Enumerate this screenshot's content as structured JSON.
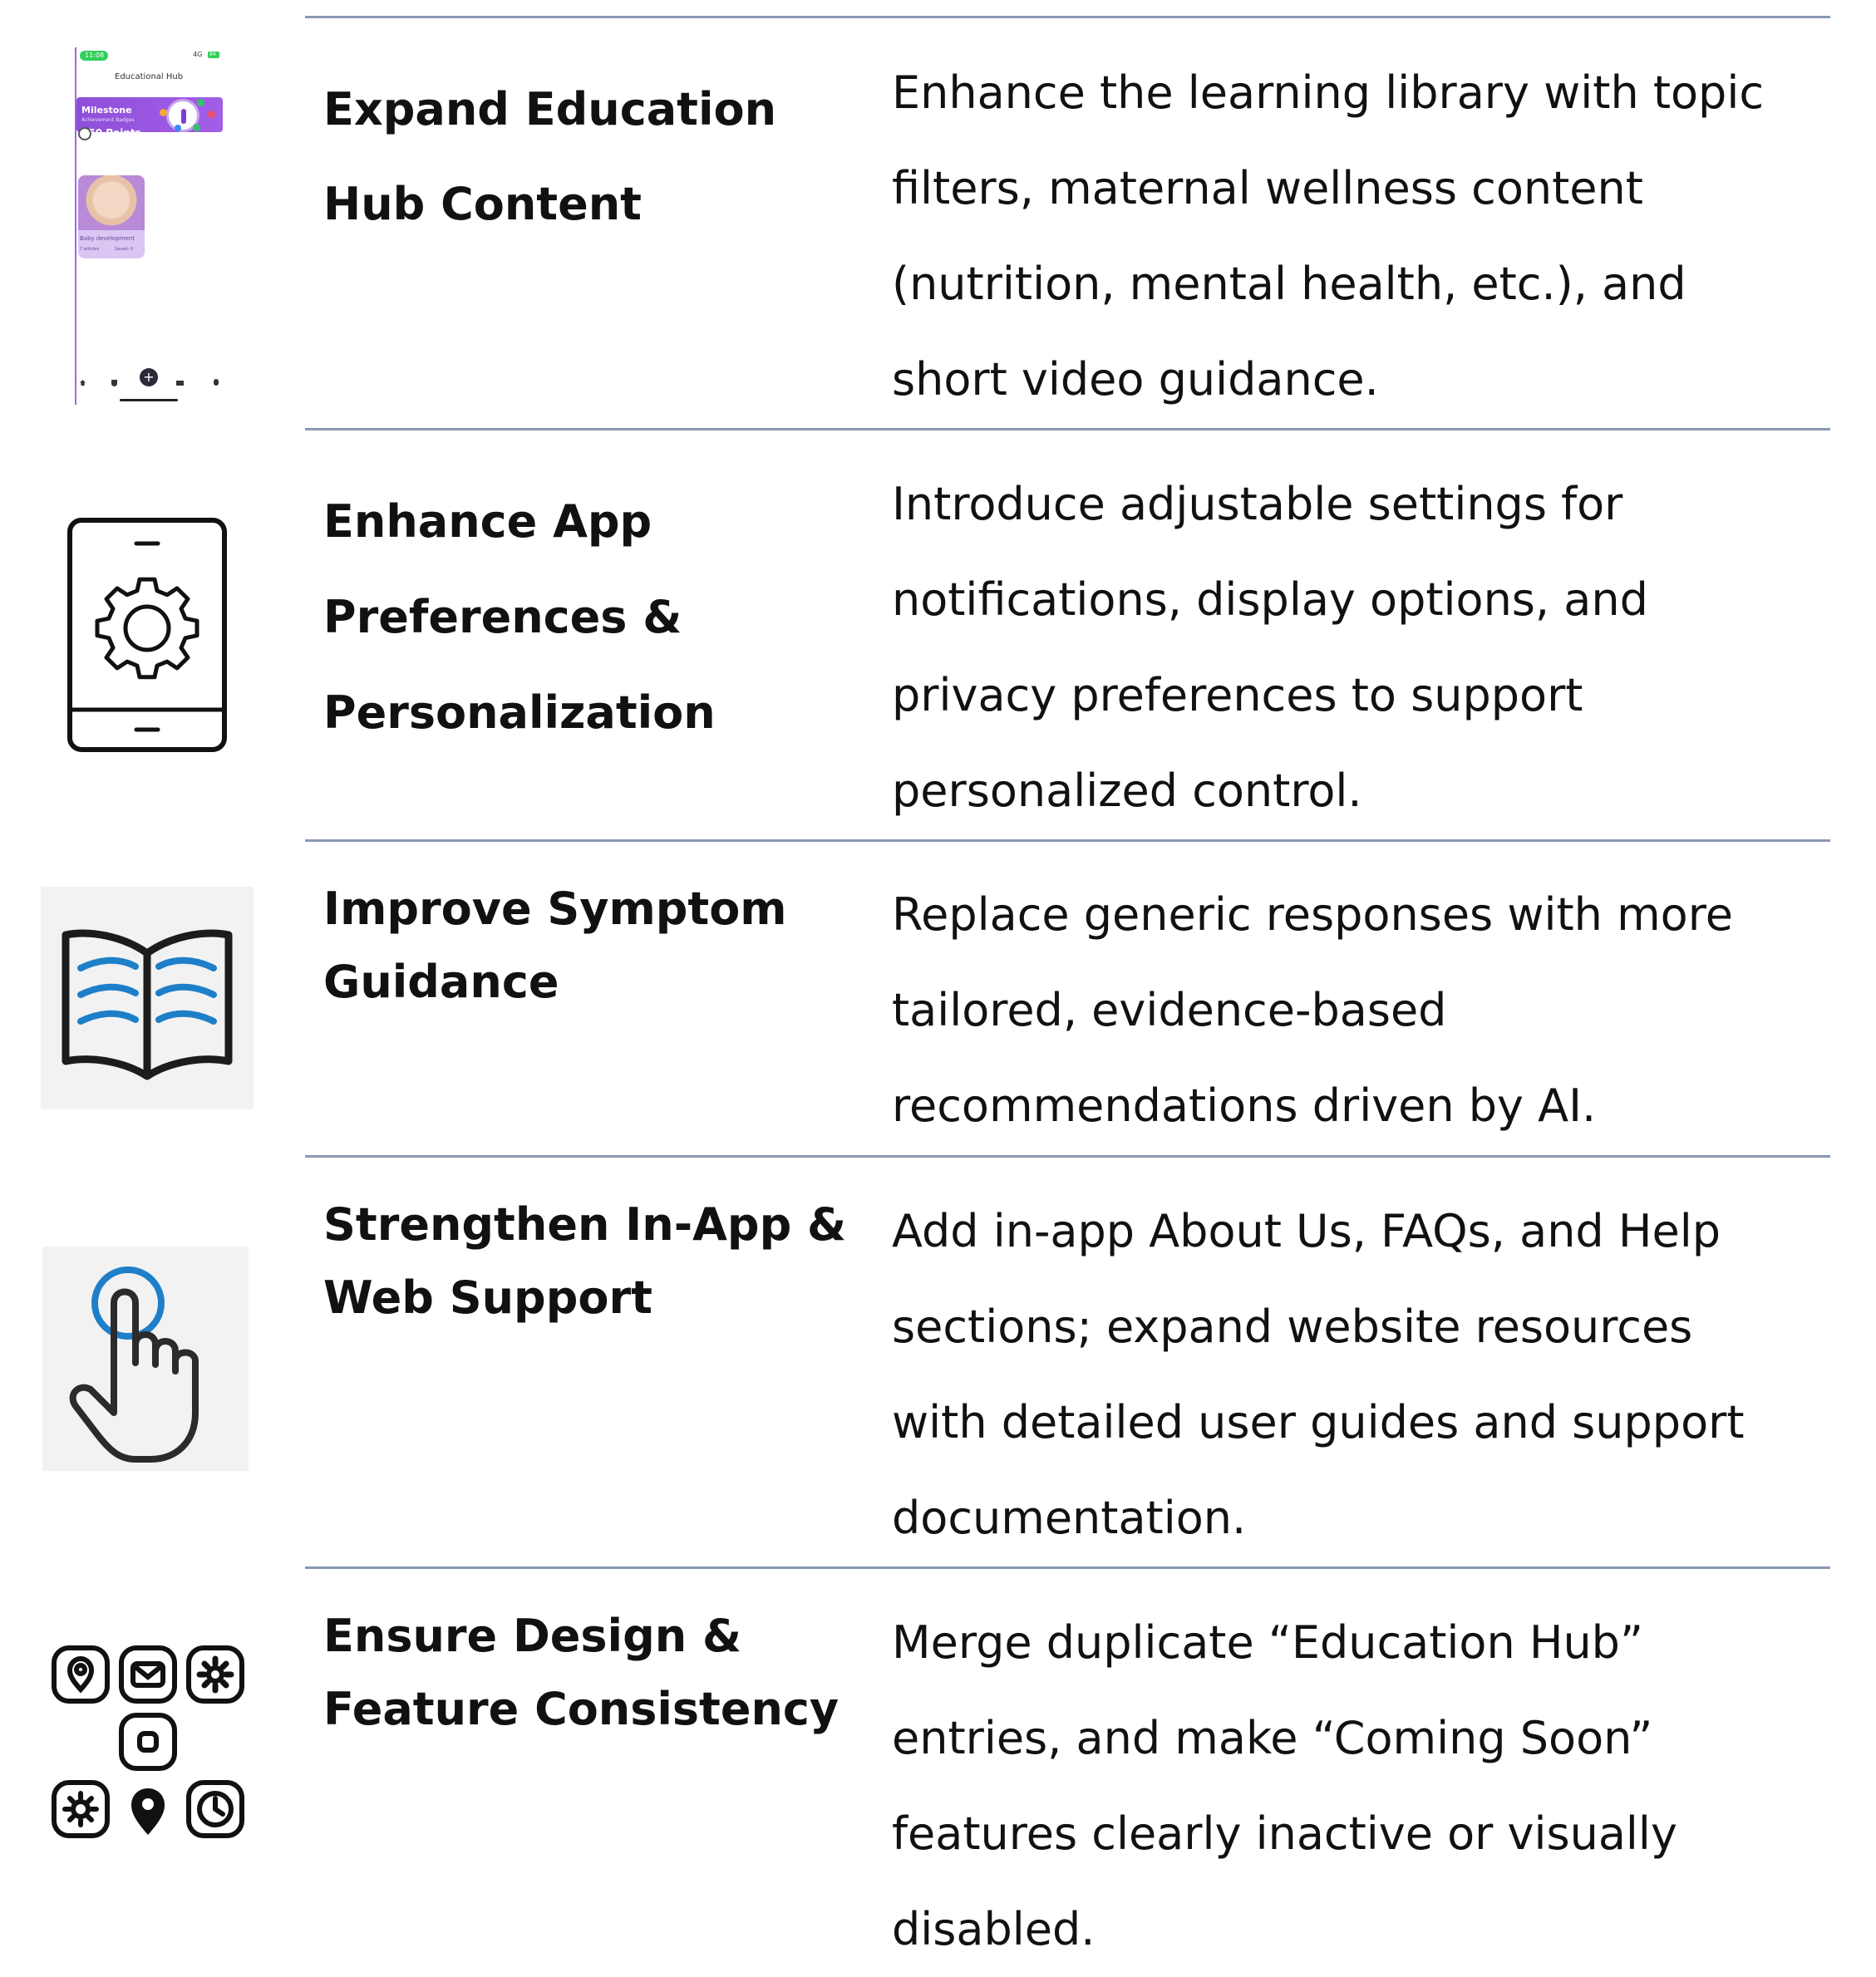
{
  "phone": {
    "time": "11:08",
    "network": "4G",
    "battery": "84",
    "header_title": "Educational Hub",
    "milestone_label": "Milestone",
    "badges_label": "Achievement Badges",
    "points_label": "250 Points",
    "card_label": "Baby development",
    "card_meta_left": "7 articles",
    "card_meta_right": "Saved: 0"
  },
  "rows": [
    {
      "title_lines": [
        "Expand Education",
        "Hub Content"
      ],
      "desc_lines": [
        "Enhance the learning library with topic",
        "filters, maternal wellness content",
        "(nutrition, mental health, etc.), and",
        "short video guidance."
      ]
    },
    {
      "title_lines": [
        "Enhance App",
        "Preferences &",
        "Personalization"
      ],
      "desc_lines": [
        "Introduce adjustable settings for",
        "notifications, display options, and",
        "privacy preferences to support",
        "personalized control."
      ]
    },
    {
      "title_lines": [
        "Improve Symptom",
        "Guidance"
      ],
      "desc_lines": [
        "Replace generic responses with more",
        "tailored, evidence-based",
        "recommendations driven by AI."
      ]
    },
    {
      "title_lines": [
        "Strengthen In-App &",
        "Web Support"
      ],
      "desc_lines": [
        "Add in-app About Us, FAQs, and Help",
        "sections; expand website resources",
        "with detailed user guides and support",
        "documentation."
      ]
    },
    {
      "title_lines": [
        "Ensure Design &",
        "Feature Consistency"
      ],
      "desc_lines": [
        "Merge duplicate “Education Hub”",
        "entries, and make “Coming Soon”",
        "features clearly inactive or visually",
        "disabled."
      ]
    }
  ]
}
